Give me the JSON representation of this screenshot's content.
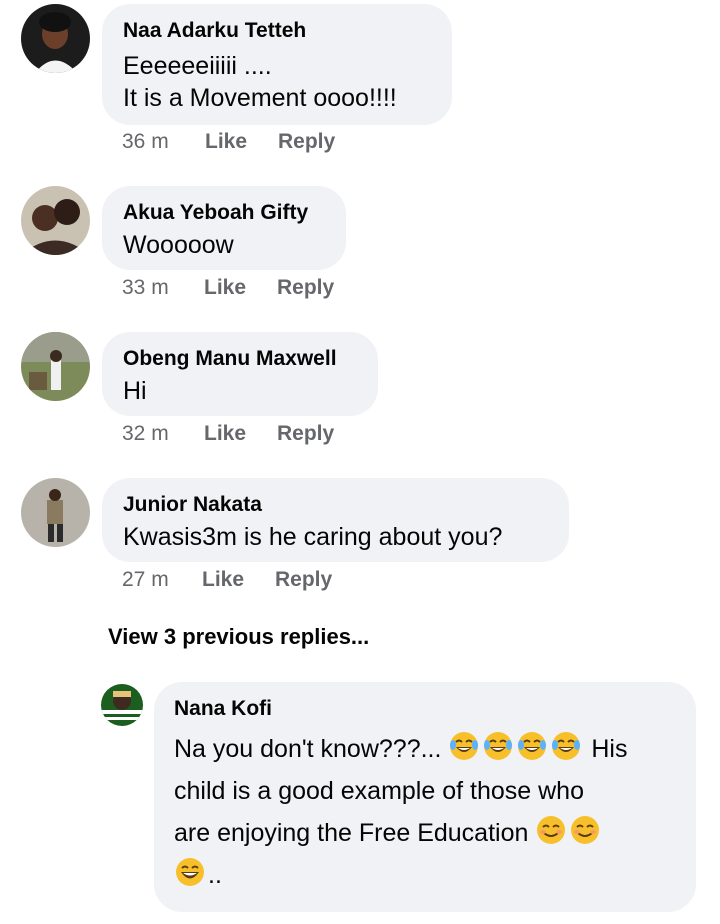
{
  "comments": [
    {
      "author": "Naa Adarku Tetteh",
      "lines": [
        "Eeeeeeiiiii ....",
        "It is a Movement oooo!!!!"
      ],
      "time": "36 m",
      "like": "Like",
      "reply": "Reply"
    },
    {
      "author": "Akua Yeboah Gifty",
      "lines": [
        "Wooooow"
      ],
      "time": "33 m",
      "like": "Like",
      "reply": "Reply"
    },
    {
      "author": "Obeng Manu Maxwell",
      "lines": [
        "Hi"
      ],
      "time": "32 m",
      "like": "Like",
      "reply": "Reply"
    },
    {
      "author": "Junior Nakata",
      "lines": [
        "Kwasis3m is he caring about you?"
      ],
      "time": "27 m",
      "like": "Like",
      "reply": "Reply"
    }
  ],
  "view_previous": "View 3 previous replies...",
  "reply": {
    "author": "Nana Kofi",
    "line1_text": "Na you don't know???...",
    "line1_after": "His",
    "line2": "child is a good example of those who",
    "line3": "are enjoying the Free Education",
    "line4_after": "..",
    "emoji_laugh": "tears-of-joy-emoji",
    "emoji_smile": "smiling-emoji",
    "emoji_grin": "grinning-emoji"
  },
  "colors": {
    "bubble": "#f0f2f5",
    "meta": "#65676b",
    "text": "#050505",
    "emoji_yellow": "#f7c02b"
  }
}
